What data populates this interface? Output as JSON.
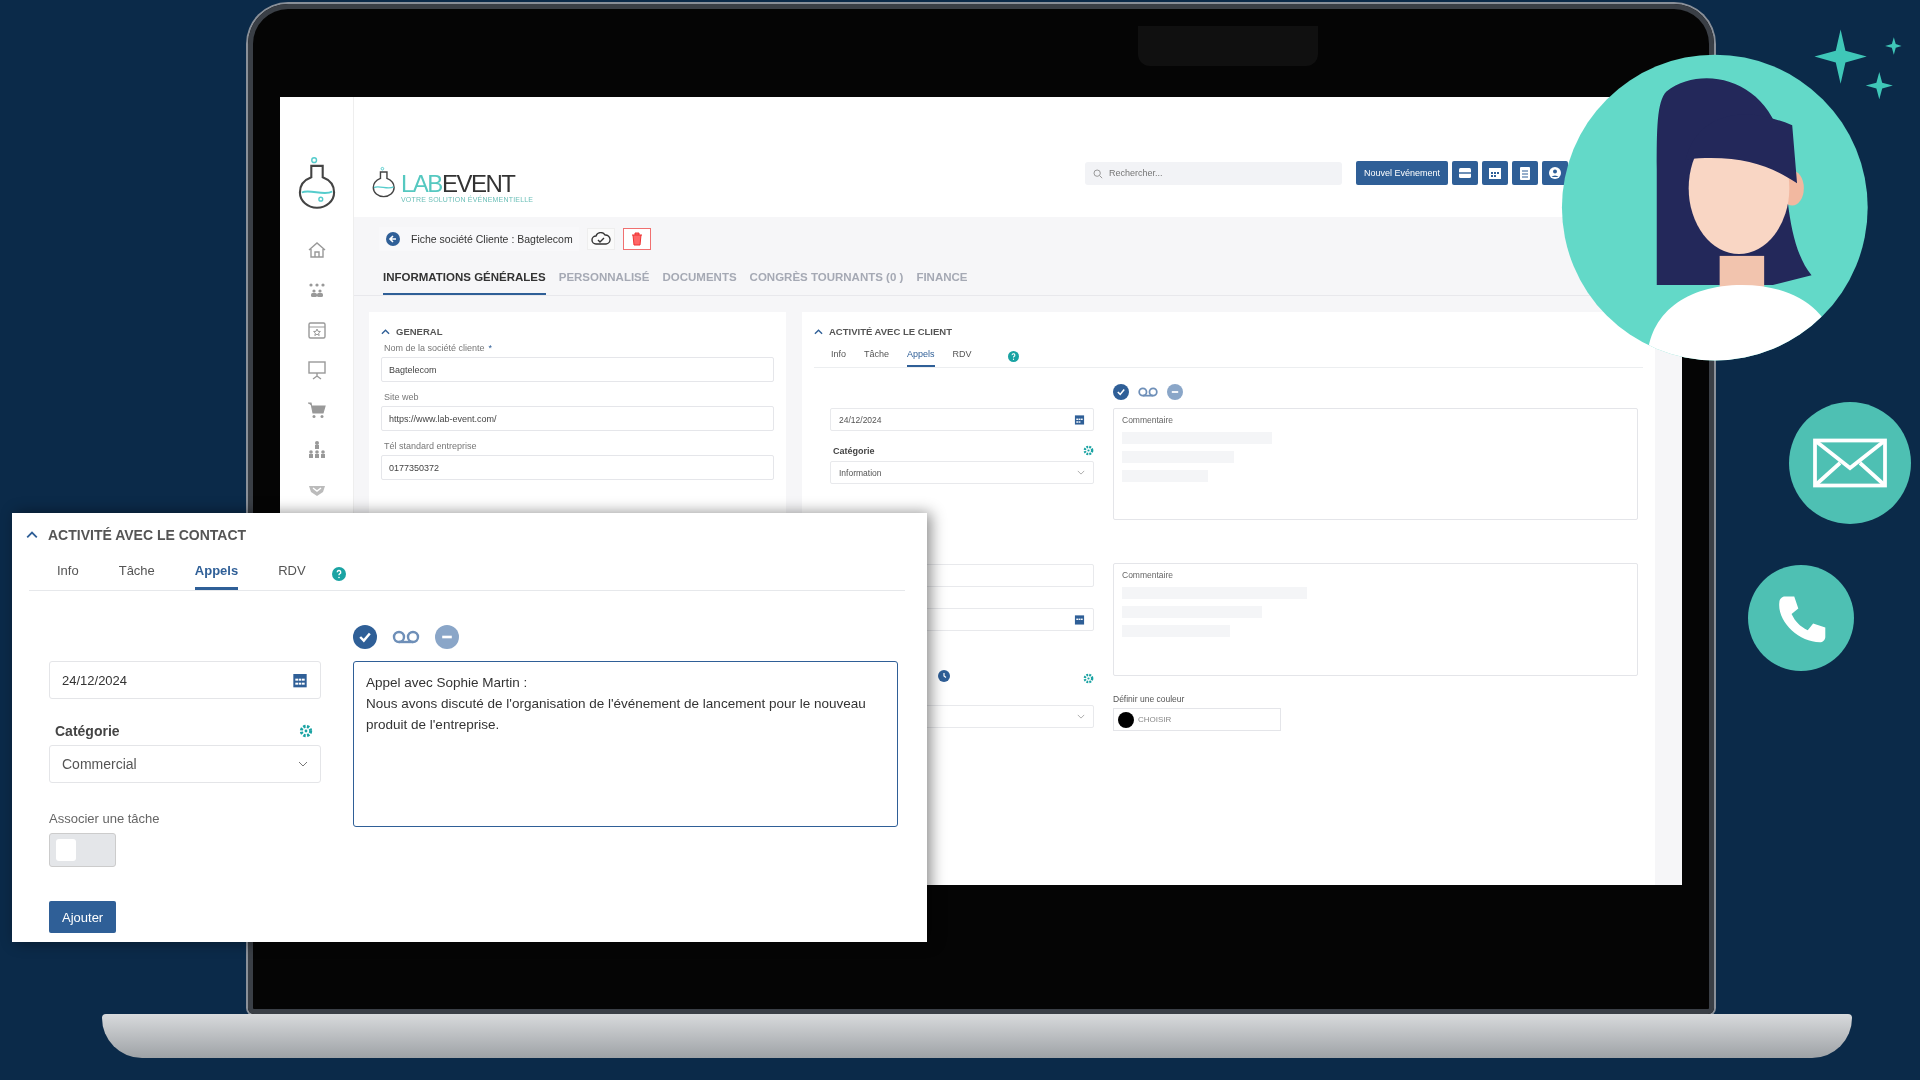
{
  "app": {
    "logo": {
      "accent": "LAB",
      "rest": "EVENT",
      "tagline": "VOTRE SOLUTION ÉVÉNEMENTIELLE"
    },
    "search": {
      "placeholder": "Rechercher..."
    },
    "new_event_button": "Nouvel Evénement",
    "breadcrumb": "Fiche société Cliente : Bagtelecom",
    "tabs": [
      {
        "label": "INFORMATIONS GÉNÉRALES",
        "selected": true
      },
      {
        "label": "PERSONNALISÉ",
        "selected": false
      },
      {
        "label": "DOCUMENTS",
        "selected": false
      },
      {
        "label": "CONGRÈS TOURNANTS (0 )",
        "selected": false
      },
      {
        "label": "FINANCE",
        "selected": false
      }
    ],
    "general": {
      "title": "GENERAL",
      "fields": [
        {
          "label": "Nom de la société cliente",
          "required_mark": "*",
          "value": "Bagtelecom"
        },
        {
          "label": "Site web",
          "value": "https://www.lab-event.com/"
        },
        {
          "label": "Tél standard entreprise",
          "value": "0177350372"
        }
      ]
    },
    "client_activity": {
      "title": "ACTIVITÉ AVEC LE CLIENT",
      "tabs": [
        {
          "label": "Info",
          "selected": false
        },
        {
          "label": "Tâche",
          "selected": false
        },
        {
          "label": "Appels",
          "selected": true
        },
        {
          "label": "RDV",
          "selected": false
        }
      ],
      "statuses": [
        {
          "kind": "done",
          "selected": true
        },
        {
          "kind": "voicemail",
          "selected": false
        },
        {
          "kind": "cancel",
          "selected": false
        }
      ],
      "date": "24/12/2024",
      "category_label": "Catégorie",
      "category": "Information",
      "comment_label": "Commentaire",
      "comment2_label": "Commentaire",
      "color_label": "Définir une couleur",
      "color_button": "CHOISIR",
      "color": "#000000"
    }
  },
  "contact_activity": {
    "title": "ACTIVITÉ AVEC LE CONTACT",
    "tabs": [
      {
        "label": "Info",
        "selected": false
      },
      {
        "label": "Tâche",
        "selected": false
      },
      {
        "label": "Appels",
        "selected": true
      },
      {
        "label": "RDV",
        "selected": false
      }
    ],
    "statuses": [
      {
        "kind": "done",
        "selected": true
      },
      {
        "kind": "voicemail",
        "selected": false
      },
      {
        "kind": "cancel",
        "selected": false
      }
    ],
    "date": "24/12/2024",
    "category_label": "Catégorie",
    "category": "Commercial",
    "comment": "Appel avec Sophie Martin :\nNous avons discuté de l'organisation de l'événement de lancement pour le nouveau produit de l'entreprise.",
    "task_label": "Associer une tâche",
    "task_on": false,
    "add_button": "Ajouter"
  }
}
